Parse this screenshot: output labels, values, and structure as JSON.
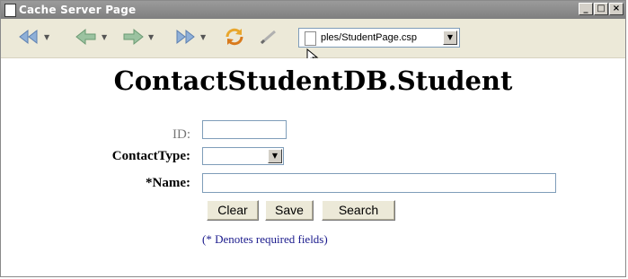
{
  "window": {
    "title": "Cache Server Page",
    "controls": {
      "minimize": "_",
      "maximize": "□",
      "close": "×"
    }
  },
  "toolbar": {
    "buttons": [
      "back",
      "forward-arrow",
      "forward",
      "go",
      "refresh",
      "edit"
    ],
    "address_text": "ples/StudentPage.csp"
  },
  "page": {
    "heading": "ContactStudentDB.Student",
    "form": {
      "id_label": "ID:",
      "id_value": "",
      "contact_type_label": "ContactType:",
      "contact_type_value": "",
      "name_label": "*Name:",
      "name_value": ""
    },
    "buttons": {
      "clear": "Clear",
      "save": "Save",
      "search": "Search"
    },
    "required_note": "(* Denotes required fields)"
  },
  "colors": {
    "titlebar": "#8a8a8a",
    "toolbar": "#ece9d8",
    "note_text": "#1a1a8c"
  }
}
